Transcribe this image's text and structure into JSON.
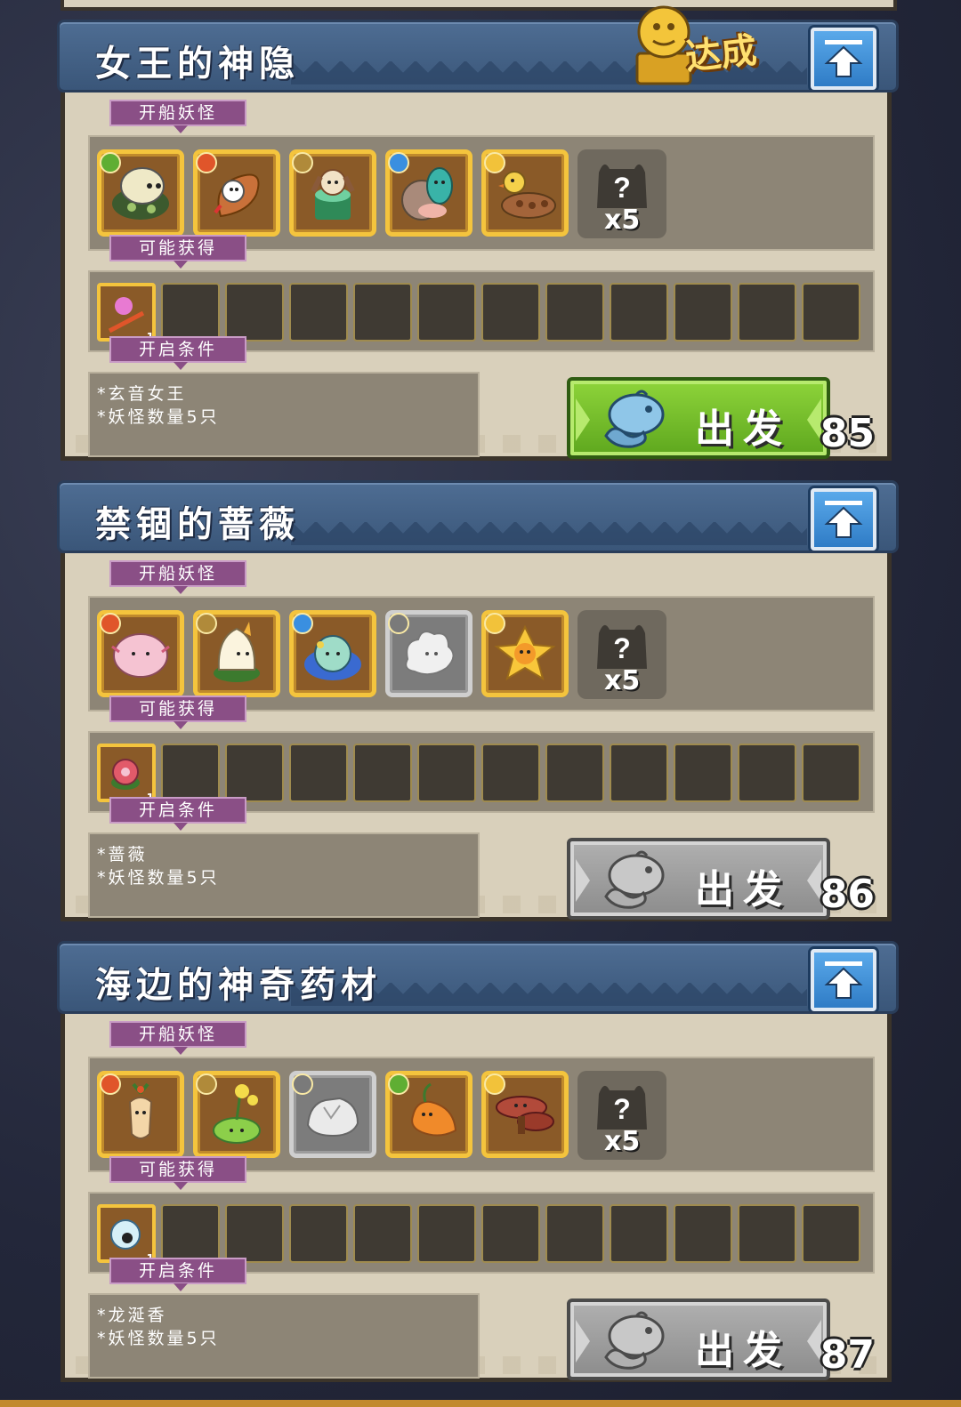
{
  "quests": [
    {
      "title": "女王的神隐",
      "achieved": true,
      "achieved_label": "达成",
      "ship_tag": "开船妖怪",
      "ship_monsters": [
        {
          "element": "grass",
          "element_color": "#5fae33",
          "icon": "turtle-leaf-creature",
          "state": "owned"
        },
        {
          "element": "fire",
          "element_color": "#e0552a",
          "icon": "lyre-bird-creature",
          "state": "owned"
        },
        {
          "element": "earth",
          "element_color": "#b08a3a",
          "icon": "mushroom-creature",
          "state": "owned"
        },
        {
          "element": "water",
          "element_color": "#3a8fe0",
          "icon": "shell-slug-creature",
          "state": "owned"
        },
        {
          "element": "light",
          "element_color": "#f2c23a",
          "icon": "duck-log-creature",
          "state": "owned"
        }
      ],
      "mystery_count": "x5",
      "reward_tag": "可能获得",
      "rewards": [
        {
          "icon": "pink-bird-item",
          "count": "1"
        }
      ],
      "empty_slots": 11,
      "cond_tag": "开启条件",
      "conditions": [
        "*玄音女王",
        "*妖怪数量5只"
      ],
      "go_label": "出发",
      "go_active": true,
      "number": "85"
    },
    {
      "title": "禁锢的蔷薇",
      "achieved": false,
      "ship_tag": "开船妖怪",
      "ship_monsters": [
        {
          "element": "fire",
          "element_color": "#e0552a",
          "icon": "pink-fluff-creature",
          "state": "owned"
        },
        {
          "element": "earth",
          "element_color": "#b08a3a",
          "icon": "bud-creature",
          "state": "owned"
        },
        {
          "element": "water",
          "element_color": "#3a8fe0",
          "icon": "blue-flower-creature",
          "state": "owned"
        },
        {
          "element": "dark",
          "element_color": "#7a7a7a",
          "icon": "white-puff-creature",
          "state": "locked"
        },
        {
          "element": "light",
          "element_color": "#f2c23a",
          "icon": "yellow-flower-creature",
          "state": "owned"
        }
      ],
      "mystery_count": "x5",
      "reward_tag": "可能获得",
      "rewards": [
        {
          "icon": "rose-item",
          "count": "1"
        }
      ],
      "empty_slots": 11,
      "cond_tag": "开启条件",
      "conditions": [
        "*蔷薇",
        "*妖怪数量5只"
      ],
      "go_label": "出发",
      "go_active": false,
      "number": "86"
    },
    {
      "title": "海边的神奇药材",
      "achieved": false,
      "ship_tag": "开船妖怪",
      "ship_monsters": [
        {
          "element": "fire",
          "element_color": "#e0552a",
          "icon": "ginseng-creature",
          "state": "owned"
        },
        {
          "element": "earth",
          "element_color": "#b08a3a",
          "icon": "flower-sprout-creature",
          "state": "owned"
        },
        {
          "element": "dark",
          "element_color": "#7a7a7a",
          "icon": "rock-creature",
          "state": "locked"
        },
        {
          "element": "grass",
          "element_color": "#5fae33",
          "icon": "carrot-creature",
          "state": "owned"
        },
        {
          "element": "light",
          "element_color": "#f2c23a",
          "icon": "lingzhi-creature",
          "state": "owned"
        }
      ],
      "mystery_count": "x5",
      "reward_tag": "可能获得",
      "rewards": [
        {
          "icon": "ghost-ball-item",
          "count": "1"
        }
      ],
      "empty_slots": 11,
      "cond_tag": "开启条件",
      "conditions": [
        "*龙涎香",
        "*妖怪数量5只"
      ],
      "go_label": "出发",
      "go_active": false,
      "number": "87"
    }
  ]
}
